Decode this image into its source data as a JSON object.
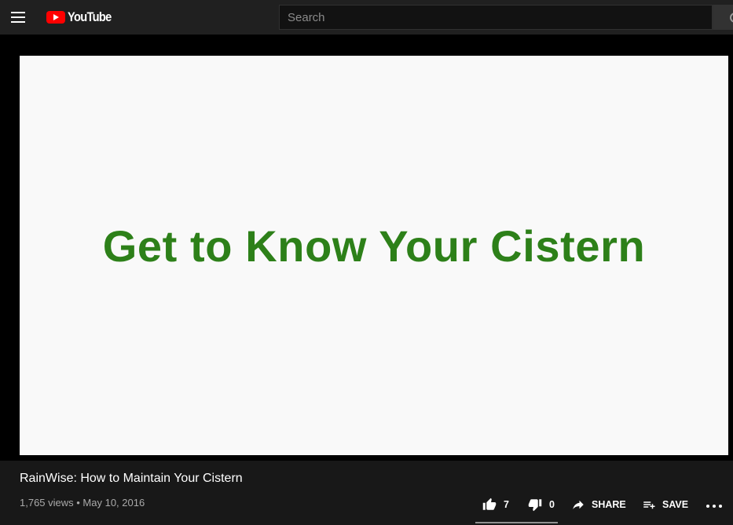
{
  "header": {
    "logo_text": "YouTube",
    "search_placeholder": "Search",
    "menu_icon": "hamburger-menu-icon",
    "search_icon": "search-icon",
    "brand_red": "#ff0000"
  },
  "video": {
    "frame_text": "Get to Know Your Cistern",
    "frame_text_color": "#2d8019"
  },
  "info": {
    "title": "RainWise: How to Maintain Your Cistern",
    "meta": "1,765 views • May 10, 2016"
  },
  "actions": {
    "like_count": "7",
    "dislike_count": "0",
    "share_label": "SHARE",
    "save_label": "SAVE",
    "more_icon": "more-options-icon"
  }
}
